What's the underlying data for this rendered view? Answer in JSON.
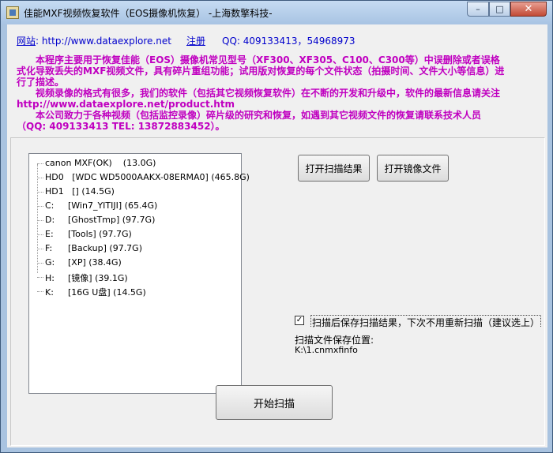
{
  "window": {
    "title": "佳能MXF视频恢复软件（EOS摄像机恢复） -上海数擎科技-",
    "controls": {
      "minimize": "–",
      "maximize": "□",
      "close": "✕"
    }
  },
  "header": {
    "site_prefix": "网站",
    "site_rest": ": http://www.dataexplore.net",
    "register": "注册",
    "qq": "QQ: 409133413，54968973"
  },
  "description": [
    "　　本程序主要用于恢复佳能（EOS）摄像机常见型号（XF300、XF305、C100、C300等）中误删除或者误格式化导致丢失的MXF视频文件，具有碎片重组功能；试用版对恢复的每个文件状态（拍摄时间、文件大小等信息）进行了描述。",
    "　　视频录像的格式有很多，我们的软件（包括其它视频恢复软件）在不断的开发和升级中，软件的最新信息请关注 http://www.dataexplore.net/product.htm",
    "　　本公司致力于各种视频（包括监控录像）碎片级的研究和恢复，如遇到其它视频文件的恢复请联系技术人员（QQ: 409133413 TEL: 13872883452）。"
  ],
  "drive_tree": [
    {
      "label": "canon MXF(OK)",
      "detail": "(13.0G)"
    },
    {
      "label": "HD0",
      "detail": "[WDC WD5000AAKX-08ERMA0] (465.8G)"
    },
    {
      "label": "HD1",
      "detail": "[] (14.5G)"
    },
    {
      "label": "C:",
      "detail": "[Win7_YITIJI] (65.4G)"
    },
    {
      "label": "D:",
      "detail": "[GhostTmp] (97.7G)"
    },
    {
      "label": "E:",
      "detail": "[Tools] (97.7G)"
    },
    {
      "label": "F:",
      "detail": "[Backup] (97.7G)"
    },
    {
      "label": "G:",
      "detail": "[XP] (38.4G)"
    },
    {
      "label": "H:",
      "detail": "[镜像] (39.1G)"
    },
    {
      "label": "K:",
      "detail": "[16G U盘] (14.5G)"
    }
  ],
  "buttons": {
    "open_scan_result": "打开扫描结果",
    "open_image_file": "打开镜像文件",
    "start_scan": "开始扫描"
  },
  "options": {
    "save_after_scan_checked": true,
    "save_after_scan_label": "扫描后保存扫描结果，下次不用重新扫描（建议选上）",
    "check_mark": "✓",
    "save_location_label": "扫描文件保存位置:",
    "save_location_path": "K:\\1.cnmxfinfo"
  }
}
